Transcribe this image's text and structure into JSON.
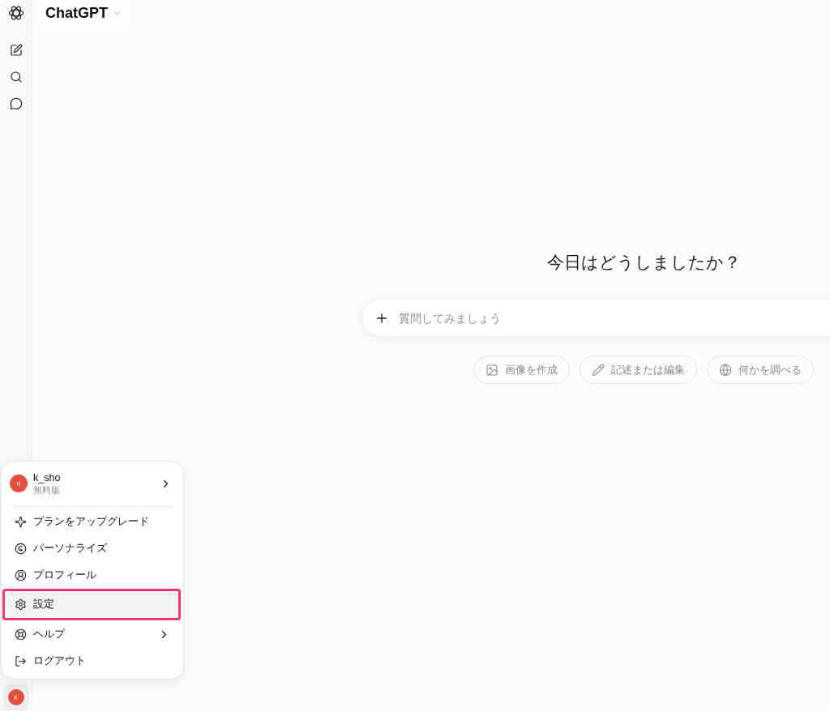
{
  "sidebar": {
    "avatar": "K"
  },
  "header": {
    "title": "ChatGPT"
  },
  "main": {
    "heading": "今日はどうしましたか？",
    "composer": {
      "placeholder": "質問してみましょう"
    },
    "suggestions": [
      {
        "kind": "image",
        "label": "画像を作成"
      },
      {
        "kind": "pen",
        "label": "記述または編集"
      },
      {
        "kind": "globe",
        "label": "何かを調べる"
      }
    ]
  },
  "account_menu": {
    "user": {
      "avatar": "K",
      "name": "k_sho",
      "plan": "無料版"
    },
    "sections": [
      {
        "items": [
          {
            "kind": "upgrade",
            "label": "プランをアップグレード",
            "submenu": false,
            "selected": false,
            "highlighted": false
          },
          {
            "kind": "personalize",
            "label": "パーソナライズ",
            "submenu": false,
            "selected": false,
            "highlighted": false
          },
          {
            "kind": "profile",
            "label": "プロフィール",
            "submenu": false,
            "selected": false,
            "highlighted": false
          },
          {
            "kind": "settings",
            "label": "設定",
            "submenu": false,
            "selected": true,
            "highlighted": true
          }
        ]
      },
      {
        "items": [
          {
            "kind": "help",
            "label": "ヘルプ",
            "submenu": true,
            "selected": false,
            "highlighted": false
          },
          {
            "kind": "logout",
            "label": "ログアウト",
            "submenu": false,
            "selected": false,
            "highlighted": false
          }
        ]
      }
    ]
  }
}
